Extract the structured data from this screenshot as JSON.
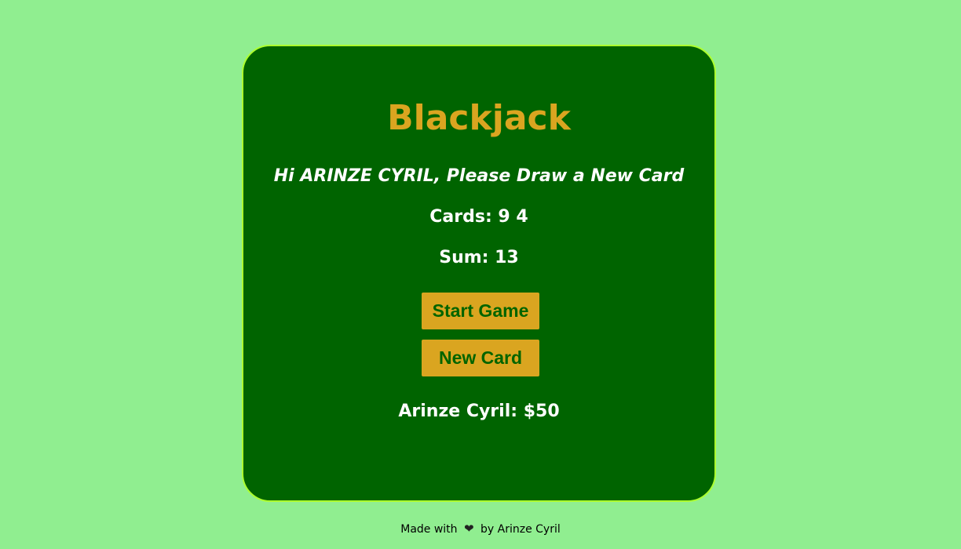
{
  "game": {
    "title": "Blackjack",
    "message": "Hi ARINZE CYRIL, Please Draw a New Card",
    "cards_text": "Cards: 9 4",
    "sum_text": "Sum: 13",
    "start_button_label": "Start Game",
    "new_card_button_label": "New Card",
    "player_text": "Arinze Cyril: $50"
  },
  "footer": {
    "made_with": "Made with",
    "heart_icon": "heart-icon",
    "heart_glyph": "❤",
    "by_author": "by Arinze Cyril"
  },
  "colors": {
    "page_background": "#90ee90",
    "table_background": "#006400",
    "table_border": "#adff2f",
    "accent_gold": "#daa520",
    "text_white": "#ffffff"
  }
}
